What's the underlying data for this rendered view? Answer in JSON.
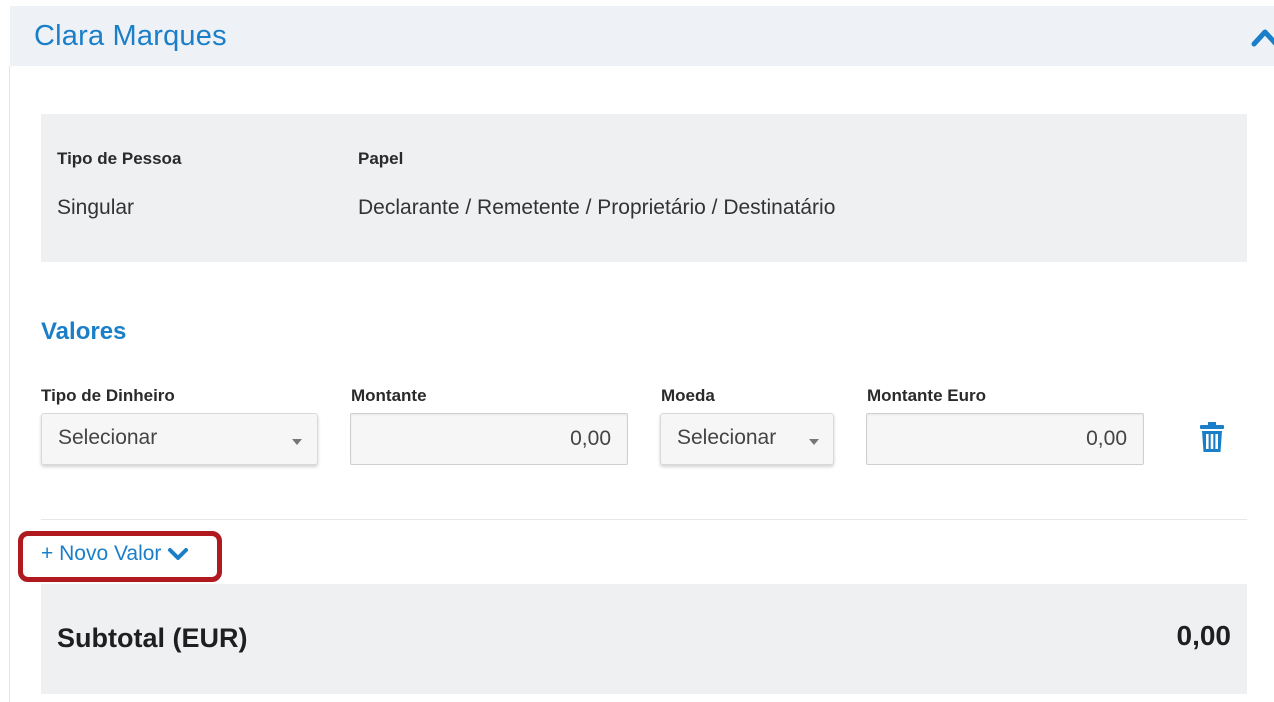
{
  "header": {
    "title": "Clara Marques",
    "collapse_icon": "chevron-up-icon"
  },
  "person": {
    "type_label": "Tipo de Pessoa",
    "type_value": "Singular",
    "role_label": "Papel",
    "role_value": "Declarante / Remetente / Proprietário / Destinatário"
  },
  "values_section": {
    "title": "Valores",
    "fields": {
      "money_type": {
        "label": "Tipo de Dinheiro",
        "value": "Selecionar"
      },
      "amount": {
        "label": "Montante",
        "value": "0,00"
      },
      "currency": {
        "label": "Moeda",
        "value": "Selecionar"
      },
      "amount_euro": {
        "label": "Montante Euro",
        "value": "0,00"
      }
    },
    "delete_icon": "trash-icon",
    "add_value_label": "+ Novo Valor",
    "add_value_icon": "chevron-down-icon"
  },
  "subtotal": {
    "label": "Subtotal (EUR)",
    "value": "0,00"
  },
  "colors": {
    "accent": "#1a7fc8",
    "highlight": "#b01a1f",
    "panel_bg": "#eff0f2",
    "header_bg": "#eef2f6"
  }
}
